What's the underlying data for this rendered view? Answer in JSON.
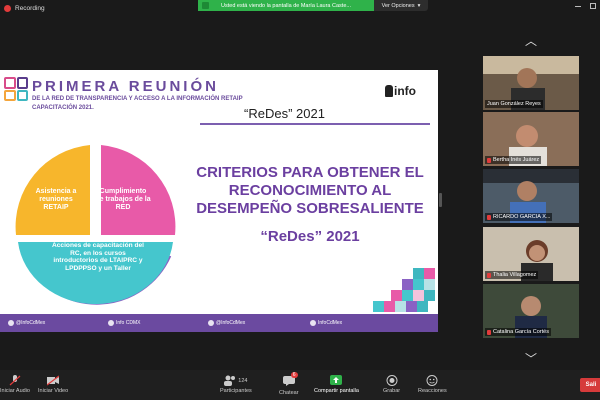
{
  "window": {
    "recording_label": "Recording",
    "share_banner": "Usted está viendo la pantalla de María Laura Caste...",
    "view_options_label": "Ver Opciones"
  },
  "slide": {
    "title": "PRIMERA REUNIÓN",
    "subtitle1": "DE LA RED DE TRANSPARENCIA Y ACCESO A LA INFORMACIÓN RETAIP",
    "subtitle2": "CAPACITACIÓN 2021.",
    "brand": "info",
    "tagline": "“ReDes” 2021",
    "cycle": {
      "yellow": "Asistencia a reuniones RETAIP",
      "pink": "Cumplimiento de trabajos de la RED",
      "cyan": "Acciones de capacitación del RC, en los cursos introductorios de LTAIPRC y LPDPPSO y un Taller",
      "colors": {
        "yellow": "#f7b62c",
        "pink": "#e85aa8",
        "cyan": "#45c6cd",
        "purple": "#8a62c4"
      }
    },
    "headline_lines": [
      "CRITERIOS PARA OBTENER EL",
      "RECONOCIMIENTO AL",
      "DESEMPEÑO SOBRESALIENTE"
    ],
    "headline_year": "“ReDes” 2021",
    "footer": {
      "twitter": "@InfoCdMex",
      "facebook": "Info CDMX",
      "instagram": "@InfoCdMex",
      "youtube": "InfoCdMex"
    },
    "accent_color": "#6b3fa0"
  },
  "participants": [
    {
      "name": "Juan González Reyes",
      "muted": false,
      "bg": "#6b5a48"
    },
    {
      "name": "Bertha Inés Juárez",
      "muted": true,
      "bg": "#8a6e58"
    },
    {
      "name": "RICARDO GARCIA X...",
      "muted": true,
      "bg": "#4d5b68"
    },
    {
      "name": "Thalia Villagomez",
      "muted": true,
      "bg": "#c9bfae"
    },
    {
      "name": "Catalina García Cortés",
      "muted": true,
      "bg": "#3e4a3a"
    }
  ],
  "toolbar": {
    "audio": "Iniciar Audio",
    "video": "Iniciar Video",
    "participants": "Participantes",
    "participants_count": "124",
    "chat": "Chatear",
    "chat_badge": "6",
    "share": "Compartir pantalla",
    "record": "Grabar",
    "reactions": "Reacciones",
    "leave": "Sali"
  }
}
